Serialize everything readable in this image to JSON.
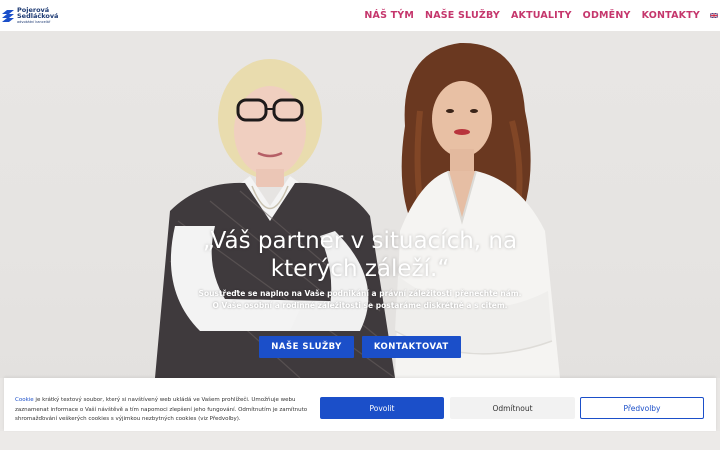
{
  "header": {
    "logo": {
      "line1": "Pojerová",
      "line2": "Sedláčková",
      "sub": "advokátní kancelář"
    },
    "nav": [
      "NÁŠ TÝM",
      "NAŠE SLUŽBY",
      "AKTUALITY",
      "ODMĚNY",
      "KONTAKTY"
    ],
    "language_icon": "uk-flag-icon"
  },
  "hero": {
    "headline": "„Váš partner v situacích, na kterých záleží.“",
    "subline1": "Soustřeďte se naplno na Vaše podnikání a právní záležitosti přenechte nám.",
    "subline2": "O Vaše osobní a rodinné záležitosti se postaráme diskrétně a s citem.",
    "btn_services": "NAŠE SLUŽBY",
    "btn_contact": "KONTAKTOVAT"
  },
  "cookie": {
    "link": "Cookie",
    "text": " je krátký textový soubor, který si navštívený web ukládá ve Vašem prohlížeči. Umožňuje webu zaznamenat informace o Vaší návštěvě a tím napomoci zlepšení jeho fungování. Odmítnutím je zamítnuto shromažďování veškerých cookies s výjimkou nezbytných cookies (viz Předvolby).",
    "accept": "Povolit",
    "deny": "Odmítnout",
    "prefs": "Předvolby"
  },
  "colors": {
    "nav": "#c5366c",
    "brand_blue": "#1b4fc9",
    "logo_navy": "#1d3a73"
  }
}
